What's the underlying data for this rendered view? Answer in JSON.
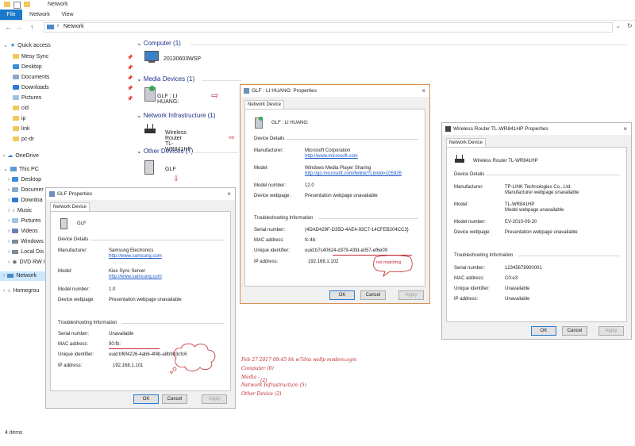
{
  "window": {
    "title": "Network"
  },
  "ribbon": {
    "tabs": [
      "File",
      "Network",
      "View"
    ]
  },
  "address": {
    "path": "Network"
  },
  "nav": {
    "items": [
      {
        "label": "Quick access"
      },
      {
        "label": "Mesy Sync"
      },
      {
        "label": "Desktop"
      },
      {
        "label": "Documents"
      },
      {
        "label": "Downloads"
      },
      {
        "label": "Pictures"
      },
      {
        "label": "cid"
      },
      {
        "label": "ip"
      },
      {
        "label": "link"
      },
      {
        "label": "pc-dr"
      },
      {
        "label": "OneDrive"
      },
      {
        "label": "This PC"
      },
      {
        "label": "Desktop"
      },
      {
        "label": "Documer"
      },
      {
        "label": "Downloa"
      },
      {
        "label": "Music"
      },
      {
        "label": "Pictures"
      },
      {
        "label": "Videos"
      },
      {
        "label": "Windows"
      },
      {
        "label": "Local Dis"
      },
      {
        "label": "DVD RW I"
      },
      {
        "label": "Network"
      },
      {
        "label": "Homegrou"
      }
    ]
  },
  "groups": {
    "computer": {
      "title": "Computer (1)",
      "device": "20130603WSP"
    },
    "media": {
      "title": "Media Devices (1)",
      "device": "GLF : LI HUANG:"
    },
    "infra": {
      "title": "Network Infrastructure (1)",
      "device": "Wireless Router TL-WR841HP"
    },
    "other": {
      "title": "Other Devices (1)",
      "device": "GLF"
    }
  },
  "status": {
    "items": "4 items"
  },
  "dlg_media": {
    "title": "GLF : LI HUANG: Properties",
    "tab": "Network Device",
    "name": "GLF : LI HUANG:",
    "details_head": "Device Details",
    "labels": {
      "manufacturer": "Manufacturer:",
      "model": "Model:",
      "model_number": "Model number:",
      "webpage": "Device webpage:"
    },
    "manufacturer": "Microsoft Corporation",
    "manufacturer_url": "http://www.microsoft.com",
    "model": "Windows Media Player Sharing",
    "model_url": "http://go.microsoft.com/fwlink/?LinkId=105926",
    "model_number": "12.0",
    "webpage": "Presentation webpage unavailable",
    "trouble_head": "Troubleshooting Information",
    "tlabels": {
      "serial": "Serial number:",
      "mac": "MAC address:",
      "uid": "Unique identifier:",
      "ip": "IP address:"
    },
    "serial": "{4DAD429F-D35D-4AE4-93C7-14CFEB204CC3}",
    "mac": "fc:4b:",
    "uid": "uuid:b7c40624-d379-43fd-a057-ef6e09",
    "ip": "192.168.1.102",
    "note": "not matching",
    "buttons": {
      "ok": "OK",
      "cancel": "Cancel",
      "apply": "Apply"
    }
  },
  "dlg_router": {
    "title": "Wireless Router TL-WR841HP Properties",
    "tab": "Network Device",
    "name": "Wireless Router TL-WR841HP",
    "details_head": "Device Details",
    "labels": {
      "manufacturer": "Manufacturer:",
      "model": "Model:",
      "model_number": "Model number:",
      "webpage": "Device webpage:"
    },
    "manufacturer": "TP-LINK Technologies Co., Ltd.",
    "manufacturer_sub": "Manufacturer webpage unavailable",
    "model": "TL-WR841HP",
    "model_sub": "Model webpage unavailable",
    "model_number": "EV-2010-09-20",
    "webpage": "Presentation webpage unavailable",
    "trouble_head": "Troubleshooting Information",
    "tlabels": {
      "serial": "Serial number:",
      "mac": "MAC address:",
      "uid": "Unique identifier:",
      "ip": "IP address:"
    },
    "serial": "12345678900001",
    "mac": "C0:e3:",
    "uid": "Unavailable",
    "ip": "Unavailable",
    "buttons": {
      "ok": "OK",
      "cancel": "Cancel",
      "apply": "Apply"
    }
  },
  "dlg_other": {
    "title": "GLF Properties",
    "tab": "Network Device",
    "name": "GLF",
    "details_head": "Device Details",
    "labels": {
      "manufacturer": "Manufacturer:",
      "model": "Model:",
      "model_number": "Model number:",
      "webpage": "Device webpage:"
    },
    "manufacturer": "Samsung Electronics",
    "manufacturer_url": "http://www.samsung.com",
    "model": "Kies Sync Server",
    "model_url": "http://www.samsung.com",
    "model_number": "1.0",
    "webpage": "Presentation webpage unavailable",
    "trouble_head": "Troubleshooting Information",
    "tlabels": {
      "serial": "Serial number:",
      "mac": "MAC address:",
      "uid": "Unique identifier:",
      "ip": "IP address:"
    },
    "serial": "Unavailable",
    "mac": "90:fb:",
    "uid": "uuid:bf6f4226-4ab6-4f4b-a8b9b3cfc6",
    "ip": "192.168.1.101",
    "buttons": {
      "ok": "OK",
      "cancel": "Cancel",
      "apply": "Apply"
    }
  },
  "annotations": {
    "line1": "Feb 27 2017 09:45 hk w7dns ws8p modem.ogm",
    "line2": "Computer (0)",
    "line3": "Media -",
    "line3b": "(2)",
    "line4": "Network Infrastructure (5)",
    "line5": "Other Device (2)"
  }
}
